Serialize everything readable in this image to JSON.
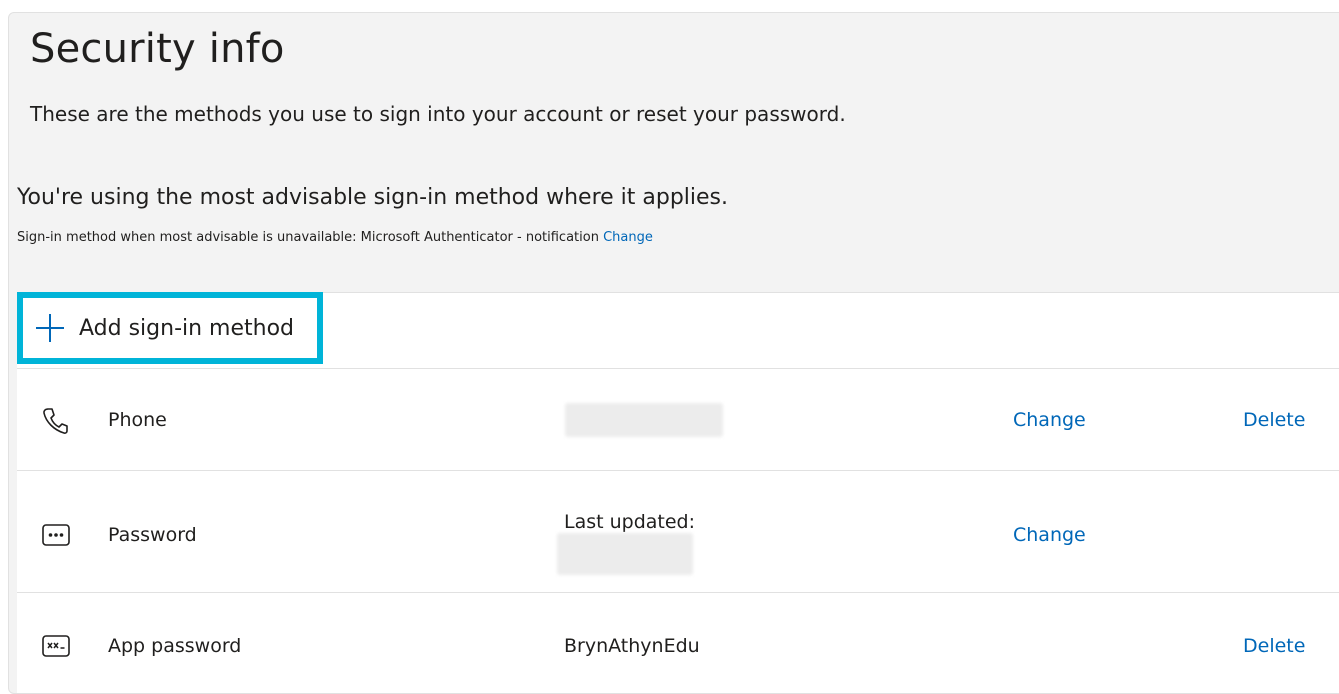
{
  "page": {
    "title": "Security info",
    "description": "These are the methods you use to sign into your account or reset your password.",
    "advisable_heading": "You're using the most advisable sign-in method where it applies.",
    "fallback_text": "Sign-in method when most advisable is unavailable: Microsoft Authenticator - notification",
    "fallback_change_link": "Change"
  },
  "add_method": {
    "label": "Add sign-in method",
    "icon": "plus-icon"
  },
  "methods": [
    {
      "name": "Phone",
      "icon": "phone-icon",
      "detail": "",
      "change_label": "Change",
      "delete_label": "Delete"
    },
    {
      "name": "Password",
      "icon": "password-dots-icon",
      "detail": "Last updated:",
      "change_label": "Change",
      "delete_label": ""
    },
    {
      "name": "App password",
      "icon": "app-password-icon",
      "detail": "BrynAthynEdu",
      "change_label": "",
      "delete_label": "Delete"
    }
  ],
  "colors": {
    "link": "#0067b8",
    "highlight": "#00b4d8",
    "panel_bg": "#f3f3f3"
  }
}
